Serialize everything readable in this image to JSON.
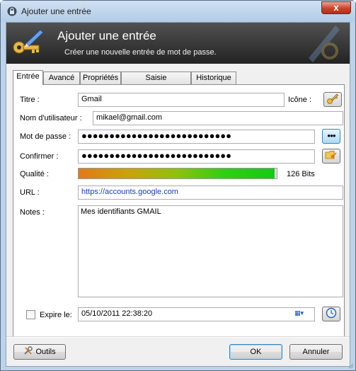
{
  "window": {
    "title": "Ajouter une entrée",
    "close_glyph": "x"
  },
  "banner": {
    "title": "Ajouter une entrée",
    "subtitle": "Créer une nouvelle entrée de mot de passe.",
    "icon": "key-pencil-icon"
  },
  "tabs": [
    {
      "label": "Entrée",
      "active": true
    },
    {
      "label": "Avancé",
      "active": false
    },
    {
      "label": "Propriétés",
      "active": false
    },
    {
      "label": "Saisie automatique",
      "active": false
    },
    {
      "label": "Historique",
      "active": false
    }
  ],
  "form": {
    "title_label": "Titre :",
    "title_value": "Gmail",
    "icon_label": "Icône :",
    "username_label": "Nom d'utilisateur :",
    "username_value": "mikael@gmail.com",
    "password_label": "Mot de passe :",
    "password_value": "●●●●●●●●●●●●●●●●●●●●●●●●●●●",
    "reveal_button": "●●●",
    "confirm_label": "Confirmer :",
    "confirm_value": "●●●●●●●●●●●●●●●●●●●●●●●●●●●",
    "quality_label": "Qualité :",
    "quality_bits": "126 Bits",
    "quality_fraction": 0.99,
    "url_label": "URL :",
    "url_value": "https://accounts.google.com",
    "notes_label": "Notes :",
    "notes_value": "Mes identifiants GMAIL",
    "expires_label": "Expire le:",
    "expires_checked": false,
    "expires_value": "05/10/2011 22:38:20"
  },
  "buttons": {
    "tools": "Outils",
    "ok": "OK",
    "cancel": "Annuler"
  },
  "colors": {
    "banner_bg": "#2b2b2b",
    "link": "#1a3fb0",
    "frame": "#bcd3ea"
  }
}
